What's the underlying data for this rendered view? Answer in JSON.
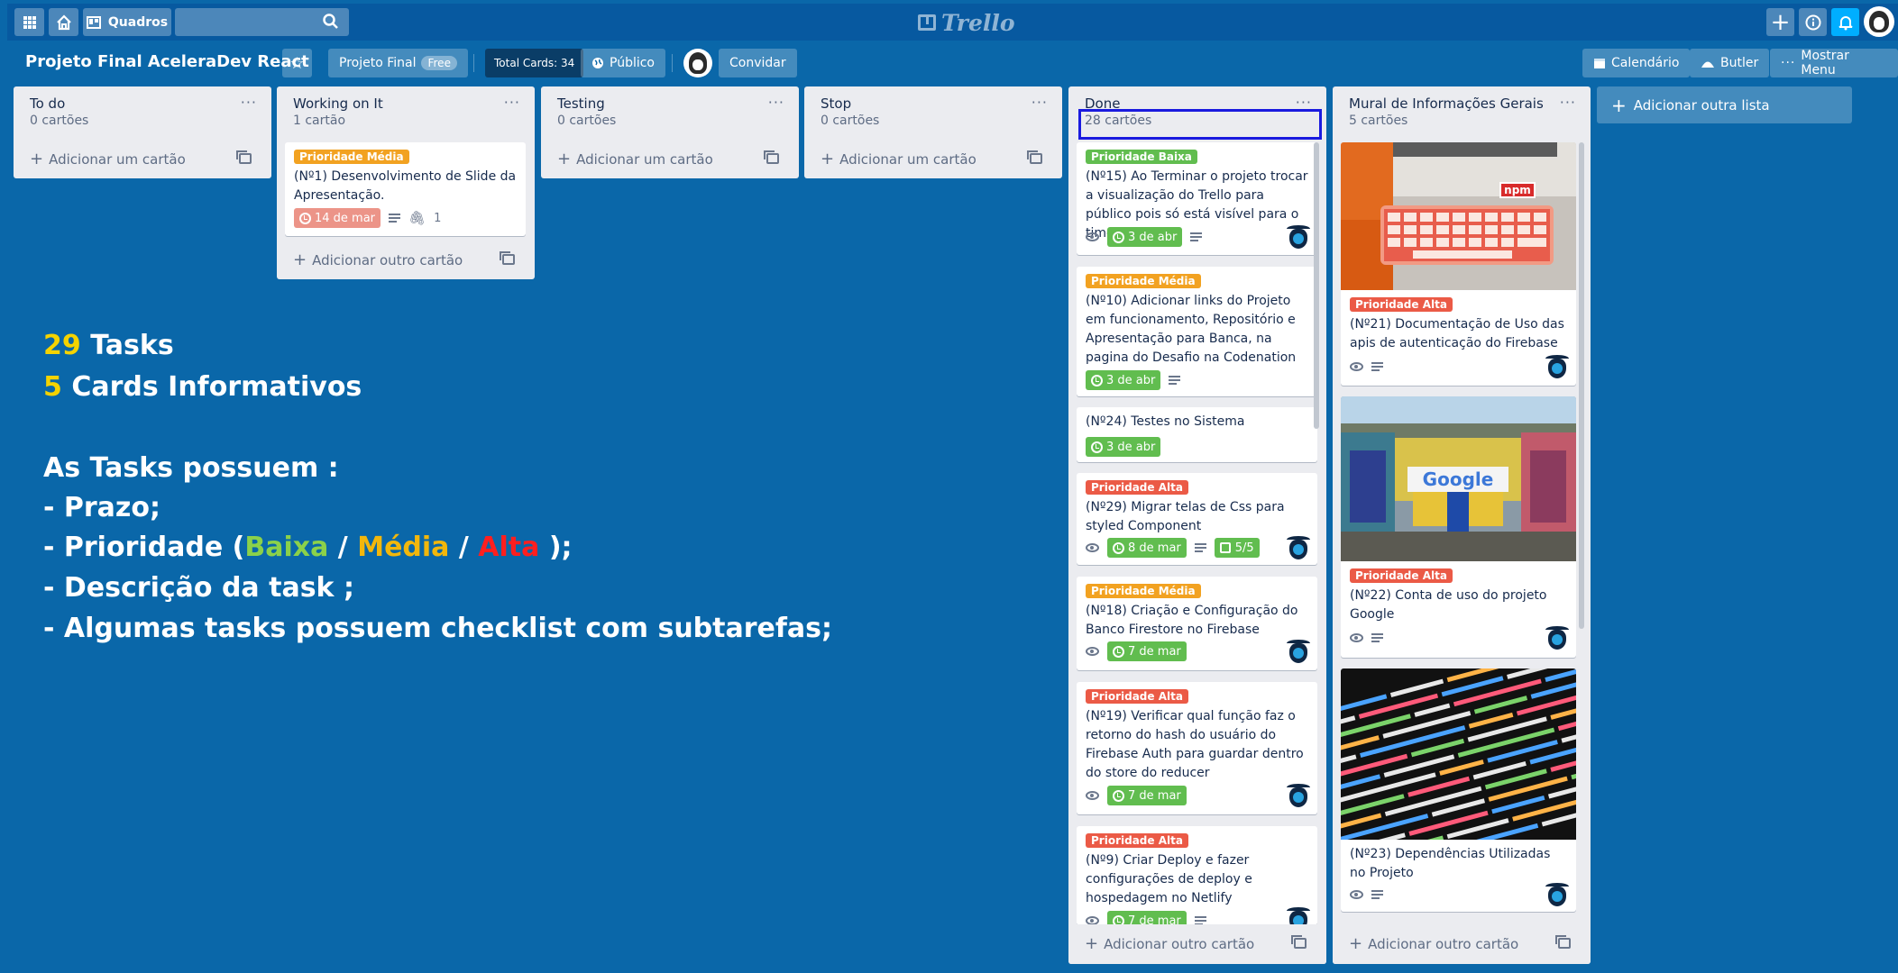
{
  "topbar": {
    "boards_label": "Quadros",
    "logo_text": "Trello"
  },
  "board": {
    "title": "Projeto Final AceleraDev React",
    "team_name": "Projeto Final",
    "team_badge": "Free",
    "total_cards": "Total Cards: 34",
    "visibility": "Público",
    "invite": "Convidar",
    "calendar": "Calendário",
    "butler": "Butler",
    "menu": "Mostrar Menu",
    "add_list": "Adicionar outra lista"
  },
  "lists": [
    {
      "title": "To do",
      "count": "0 cartões",
      "add": "Adicionar um cartão"
    },
    {
      "title": "Working on It",
      "count": "1 cartão",
      "add": "Adicionar outro cartão",
      "cards": [
        {
          "label": "Prioridade Média",
          "text": "(Nº1) Desenvolvimento de Slide da Apresentação.",
          "due": "14 de mar",
          "attachments": "1"
        }
      ]
    },
    {
      "title": "Testing",
      "count": "0 cartões",
      "add": "Adicionar um cartão"
    },
    {
      "title": "Stop",
      "count": "0 cartões",
      "add": "Adicionar um cartão"
    },
    {
      "title": "Done",
      "count": "28 cartões",
      "add": "Adicionar outro cartão",
      "cards": [
        {
          "label": "Prioridade Baixa",
          "text": "(Nº15) Ao Terminar o projeto trocar a visualização do Trello para público pois só está visível para o time",
          "due": "3 de abr"
        },
        {
          "label": "Prioridade Média",
          "text": "(Nº10) Adicionar links do Projeto em funcionamento, Repositório e Apresentação para Banca, na pagina do Desafio na Codenation",
          "due": "3 de abr"
        },
        {
          "label": "",
          "text": "(Nº24) Testes no Sistema",
          "due": "3 de abr"
        },
        {
          "label": "Prioridade Alta",
          "text": "(Nº29) Migrar telas de Css para styled Component",
          "due": "8 de mar",
          "checklist": "5/5"
        },
        {
          "label": "Prioridade Média",
          "text": "(Nº18) Criação e Configuração do Banco Firestore no Firebase",
          "due": "7 de mar"
        },
        {
          "label": "Prioridade Alta",
          "text": "(Nº19) Verificar qual função faz o retorno do hash do usuário do Firebase Auth para guardar dentro do store do reducer",
          "due": "7 de mar"
        },
        {
          "label": "Prioridade Alta",
          "text": "(Nº9) Criar Deploy e fazer configurações de deploy e hospedagem no Netlify",
          "due": "7 de mar"
        }
      ]
    },
    {
      "title": "Mural de Informações Gerais",
      "count": "5 cartões",
      "add": "Adicionar outro cartão",
      "cards": [
        {
          "label": "Prioridade Alta",
          "text": "(Nº21) Documentação de Uso das apis de autenticação do Firebase",
          "image_text": "npm"
        },
        {
          "label": "Prioridade Alta",
          "text": "(Nº22) Conta de uso do projeto Google",
          "image_text": "Google"
        },
        {
          "label": "",
          "text": "(Nº23) Dependências Utilizadas no Projeto"
        }
      ]
    }
  ],
  "overlay": {
    "tasks_num": "29",
    "tasks_label": "Tasks",
    "info_num": "5",
    "info_label": "Cards Informativos",
    "heading": "As Tasks possuem :",
    "item1": "- Prazo;",
    "item2_prefix": "- Prioridade (",
    "baixa": "Baixa",
    "slash1": " / ",
    "media": "Média",
    "slash2": " / ",
    "alta": "Alta",
    "item2_suffix": " );",
    "item3": "- Descrição da task ;",
    "item4": "- Algumas tasks possuem checklist com subtarefas;"
  },
  "colors": {
    "board_bg": "#0a67a9",
    "label_baixa": "#61bd4f",
    "label_media": "#f2a221",
    "label_alta": "#eb5a46",
    "highlight": "#1a1adf"
  }
}
